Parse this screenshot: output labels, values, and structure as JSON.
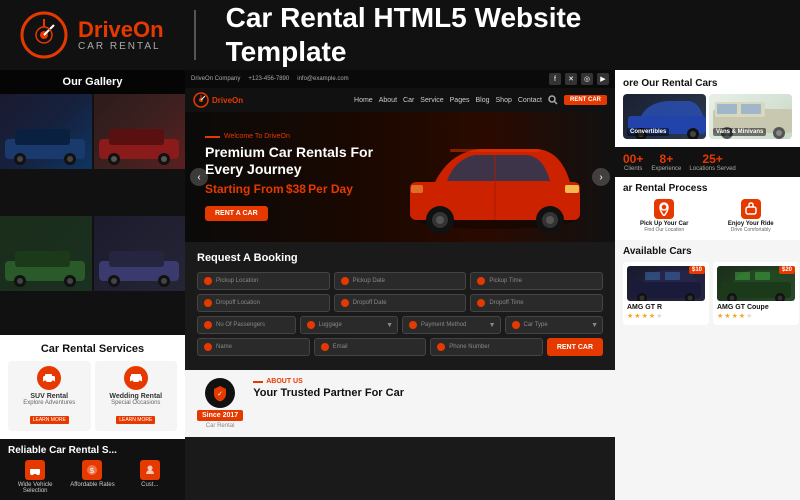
{
  "header": {
    "logo_name_part1": "Drive",
    "logo_name_part2": "On",
    "logo_sub": "CAR RENTAL",
    "title_line1": "Car Rental HTML5 Website",
    "title_line2": "Template"
  },
  "mockup": {
    "topbar": {
      "company": "DriveOn Company",
      "phone": "+123-456-7890",
      "email": "info@example.com"
    },
    "nav": {
      "logo_part1": "Drive",
      "logo_part2": "On",
      "links": [
        "Home",
        "About",
        "Car",
        "Service",
        "Pages",
        "Blog",
        "Shop",
        "Contact"
      ],
      "rent_btn": "RENT CAR"
    },
    "hero": {
      "subtitle": "Welcome To DriveOn",
      "title_line1": "Premium Car Rentals For",
      "title_line2": "Every Journey",
      "price_label": "Starting From",
      "price": "$38",
      "price_suffix": "Per Day",
      "cta": "RENT A CAR"
    },
    "booking": {
      "title": "Request A Booking",
      "fields": [
        "Pickup Location",
        "Pickup Date",
        "Pickup Time",
        "Dropoff Location",
        "Dropoff Date",
        "Dropoff Time",
        "No Of Passengers",
        "Luggage",
        "Payment Method",
        "Car Type",
        "Name",
        "Email",
        "Phone Number"
      ],
      "submit": "RENT CAR"
    },
    "about": {
      "tag": "ABOUT US",
      "title": "Your Trusted Partner For Car",
      "since_year": "Since 2017",
      "sub_label": "Car Rental"
    }
  },
  "left_panel": {
    "gallery_title": "Our Gallery",
    "service_title": "Car Rental Services",
    "services": [
      {
        "label": "SUV Rental",
        "desc": "Explore Adventures"
      },
      {
        "label": "Wedding Rental",
        "desc": "Special Occasions"
      }
    ],
    "reliable_title": "Reliable Car Rental S...",
    "features": [
      {
        "label": "Wide Vehicle Selection"
      },
      {
        "label": "Affordable Rates"
      },
      {
        "label": "Cust..."
      }
    ]
  },
  "right_panel": {
    "rental_title": "ore Our Rental Cars",
    "categories": [
      {
        "label": "Convertibles"
      },
      {
        "label": "Vans & Minivans"
      }
    ],
    "stats": [
      {
        "num": "00+",
        "label": "Clients"
      },
      {
        "num": "8+",
        "label": "Experience"
      },
      {
        "num": "25+",
        "label": "Locations Served"
      }
    ],
    "process_title": "ar Rental Process",
    "steps": [
      {
        "icon": "01",
        "title": "Pick Up Your Car",
        "desc": "Find Our Location"
      },
      {
        "icon": "02",
        "title": "Enjoy Your Ride",
        "desc": "Drive Comfortably"
      }
    ],
    "available_title": "Available Cars",
    "cars": [
      {
        "name": "AMG GT R",
        "price": "$10",
        "rating": 4
      },
      {
        "name": "AMG GT Coupe",
        "price": "$20",
        "rating": 4
      }
    ]
  }
}
